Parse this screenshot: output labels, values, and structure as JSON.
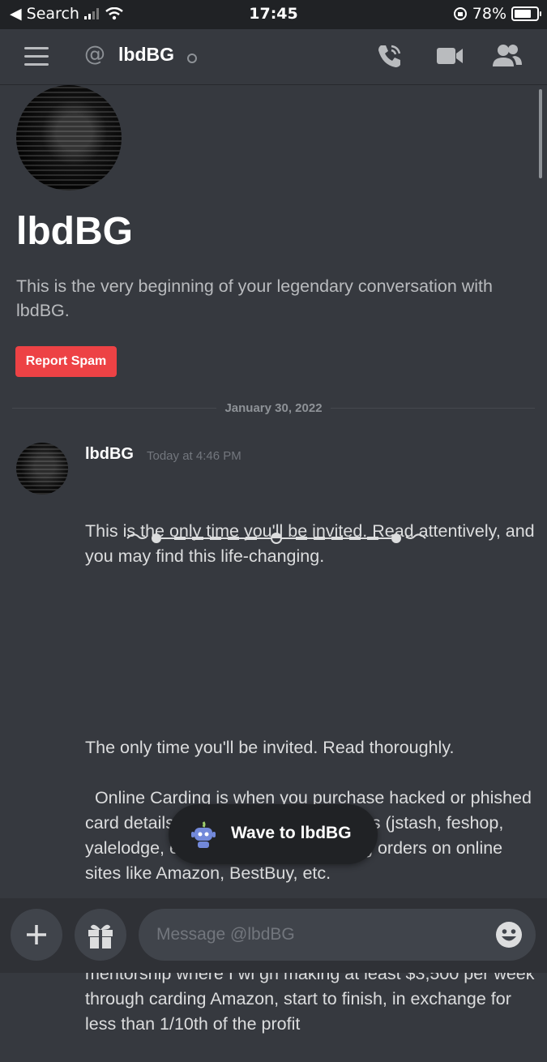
{
  "status_bar": {
    "back_label": "◀ Search",
    "time": "17:45",
    "battery": "78%",
    "battery_level": 0.78
  },
  "header": {
    "title": "lbdBG",
    "icons": [
      "menu-icon",
      "at-icon",
      "call-icon",
      "video-icon",
      "members-icon"
    ]
  },
  "profile": {
    "name": "lbdBG",
    "intro": "This is the very beginning of your legendary conversation with lbdBG.",
    "report_button": "Report Spam"
  },
  "date_divider": "January 30, 2022",
  "message": {
    "author": "lbdBG",
    "timestamp": "Today at 4:46 PM",
    "line1": "This is the only time you'll be invited. Read attentively, and you may find this life-changing.",
    "body": "The only time you'll be invited. Read thoroughly.\n\n  Online Carding is when you purchase hacked or phished card details for $10-$20 via autoshops (jstash, feshop, yalelodge, etc) and use it to place big orders on online sites like Amazon, BestBuy, etc.\n\n  Assuming you could navigate Amazon's fraud detection, you could place an $800 order using said card. What a mentorship where I wi gh making at least $3,500 per week through carding Amazon, start to finish, in exchange for less than 1/10th of the profit"
  },
  "wave_button": "Wave to lbdBG",
  "composer": {
    "placeholder": "Message @lbdBG"
  },
  "colors": {
    "background": "#36393f",
    "statusbar": "#202225",
    "report": "#ed4245",
    "input": "#40444b"
  }
}
